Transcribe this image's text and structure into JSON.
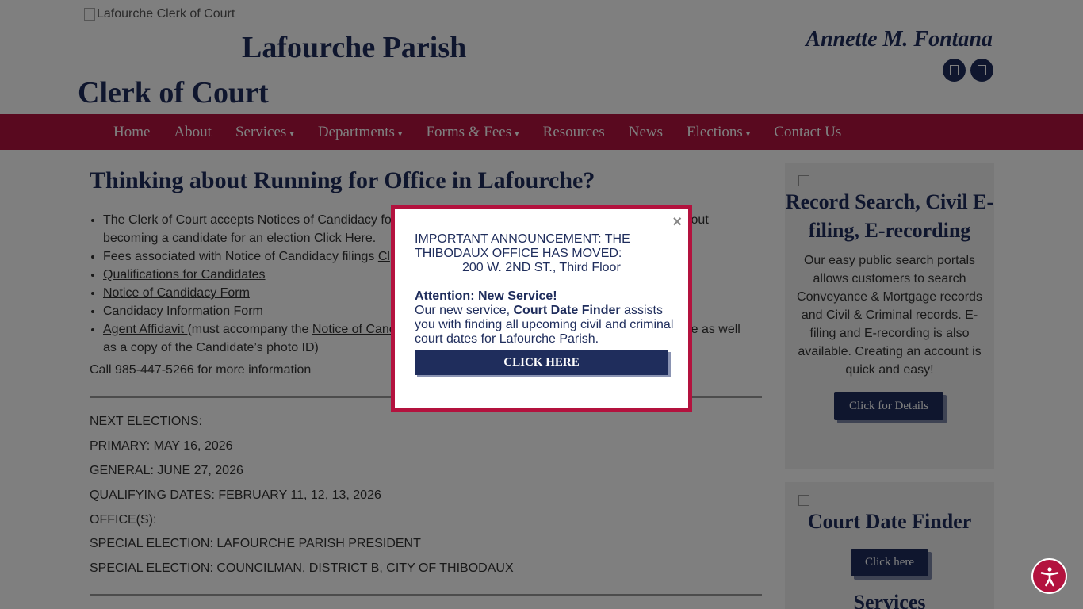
{
  "header": {
    "logo_alt": "Lafourche Clerk of Court",
    "title_line1": "Lafourche Parish",
    "title_line2": "Clerk of Court",
    "official_name": "Annette M. Fontana",
    "social_icons": [
      "facebook-icon",
      "twitter-icon"
    ]
  },
  "nav": {
    "items": [
      {
        "label": "Home",
        "dropdown": false
      },
      {
        "label": "About",
        "dropdown": false
      },
      {
        "label": "Services",
        "dropdown": true
      },
      {
        "label": "Departments",
        "dropdown": true
      },
      {
        "label": "Forms & Fees",
        "dropdown": true
      },
      {
        "label": "Resources",
        "dropdown": false
      },
      {
        "label": "News",
        "dropdown": false
      },
      {
        "label": "Elections",
        "dropdown": true
      },
      {
        "label": "Contact Us",
        "dropdown": false
      }
    ],
    "caret": "▾"
  },
  "main": {
    "title": "Thinking about Running for Office in Lafourche?",
    "bullet1_pre": "The Clerk of Court accepts Notices of Candidacy fo",
    "bullet1_post": "bout",
    "bullet1_line2": "becoming a candidate for an election ",
    "bullet1_link": "Click Here",
    "bullet1_end": ".",
    "bullet2_pre": "Fees associated with Notice of Candidacy filings ",
    "bullet2_link": "Cl",
    "bullet3_link": "Qualifications for Candidates",
    "bullet4_link": "Notice of Candidacy Form",
    "bullet5_link": "Candidacy Information Form",
    "bullet6_link": "Agent Affidavit ",
    "bullet6_mid": "(must accompany the ",
    "bullet6_link2": "Notice of Canc",
    "bullet6_post": "ate as well",
    "bullet6_line2": "as a copy of the Candidate’s photo ID)",
    "call": "Call 985-447-5266 for more information",
    "elections": [
      "NEXT ELECTIONS:",
      "PRIMARY: MAY 16, 2026",
      "GENERAL: JUNE 27, 2026",
      "QUALIFYING DATES: FEBRUARY 11, 12, 13, 2026",
      "OFFICE(S):",
      "SPECIAL ELECTION: LAFOURCHE PARISH PRESIDENT",
      "SPECIAL ELECTION: COUNCILMAN, DISTRICT B, CITY OF THIBODAUX"
    ]
  },
  "sidebar": {
    "box1": {
      "title": "Record Search, Civil E-filing, E-recording",
      "text": "Our easy public search portals allows customers to search Conveyance & Mortgage records and Civil & Criminal records. E-filing and E-recording is also available. Creating an account is quick and easy!",
      "button": "Click for Details"
    },
    "box2": {
      "title": "Court Date Finder",
      "button": "Click here",
      "next_title": "Services"
    }
  },
  "modal": {
    "close": "×",
    "line1": "IMPORTANT ANNOUNCEMENT: THE",
    "line2": "THIBODAUX OFFICE HAS MOVED:",
    "address": "200 W. 2ND ST., Third Floor",
    "attention": "Attention: New Service!",
    "service_pre": "Our new service,  ",
    "service_name": "Court Date Finder",
    "service_post": " assists you with finding all upcoming civil and criminal court dates for Lafourche Parish.",
    "button": "CLICK HERE"
  },
  "accessibility": {
    "icon": "accessibility-icon"
  },
  "colors": {
    "navy": "#1f2d5c",
    "crimson": "#b3123e"
  }
}
